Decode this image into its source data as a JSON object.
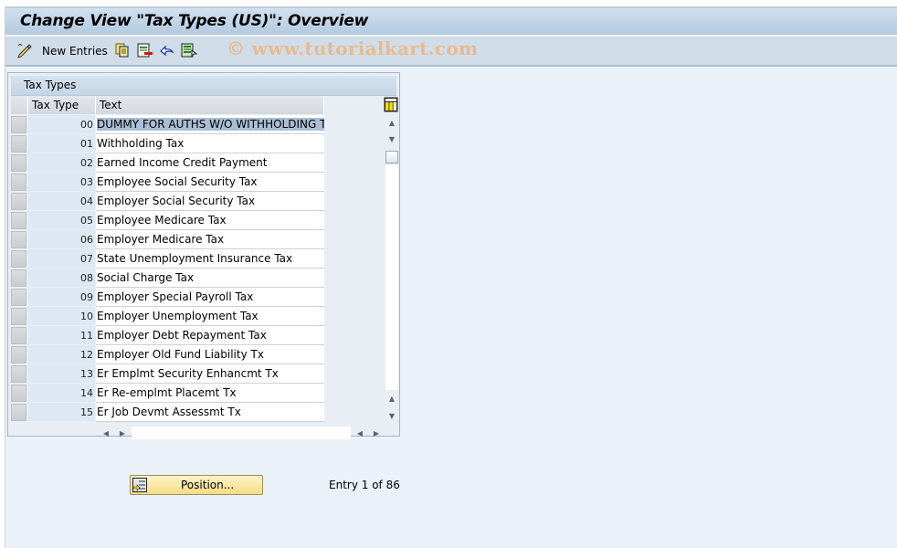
{
  "window": {
    "title": "Change View \"Tax Types (US)\": Overview"
  },
  "toolbar": {
    "new_entries_label": "New Entries",
    "icons": [
      "new-entries-icon",
      "copy-icon",
      "delete-icon",
      "undo-icon",
      "select-all-icon"
    ],
    "watermark": "© www.tutorialkart.com"
  },
  "panel": {
    "title": "Tax Types",
    "columns": [
      "Tax Type",
      "Text"
    ],
    "rows": [
      {
        "key": "00",
        "text": "DUMMY FOR AUTHS W/O WITHHOLDING T…",
        "selected": true
      },
      {
        "key": "01",
        "text": "Withholding Tax"
      },
      {
        "key": "02",
        "text": "Earned Income Credit Payment"
      },
      {
        "key": "03",
        "text": "Employee Social Security Tax"
      },
      {
        "key": "04",
        "text": "Employer Social Security Tax"
      },
      {
        "key": "05",
        "text": "Employee Medicare Tax"
      },
      {
        "key": "06",
        "text": "Employer Medicare Tax"
      },
      {
        "key": "07",
        "text": "State Unemployment Insurance Tax"
      },
      {
        "key": "08",
        "text": "Social Charge Tax"
      },
      {
        "key": "09",
        "text": "Employer Special Payroll Tax"
      },
      {
        "key": "10",
        "text": "Employer Unemployment Tax"
      },
      {
        "key": "11",
        "text": "Employer Debt Repayment Tax"
      },
      {
        "key": "12",
        "text": "Employer Old Fund Liability Tx"
      },
      {
        "key": "13",
        "text": "Er Emplmt Security Enhancmt Tx"
      },
      {
        "key": "14",
        "text": "Er Re-emplmt Placemt Tx"
      },
      {
        "key": "15",
        "text": "Er Job Devmt Assessmt Tx"
      }
    ]
  },
  "footer": {
    "position_button": "Position...",
    "entry_text": "Entry 1 of 86"
  }
}
